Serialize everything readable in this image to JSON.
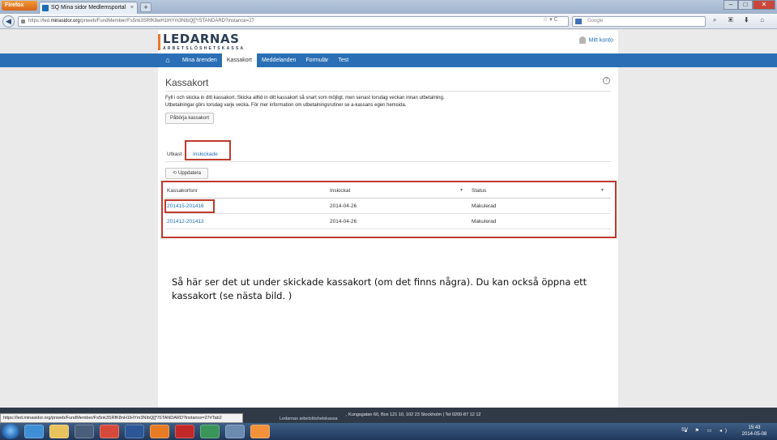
{
  "browser": {
    "menu_button": "Firefox",
    "tab_title": "SQ Mina sidor Medlemsportal",
    "new_tab": "+",
    "url_prefix": "https://led.",
    "url_host": "minasidor.org",
    "url_rest": "/pnweb/FundMember/Fs5nk3SRfK8wH1lHYm3NIbQ[[*/STANDARD?instance=27",
    "search_placeholder": "Google",
    "url_icons": "☆ ▾ C",
    "tools": "⌕ ▣ ⬇ ⌂"
  },
  "site": {
    "logo_word": "LEDARNAS",
    "logo_sub": "ARBETSLÖSHETSKASSA",
    "account_label": "Mitt konto"
  },
  "menu": {
    "items": [
      "Mina ärenden",
      "Kassakort",
      "Meddelanden",
      "Formulär",
      "Test"
    ],
    "active": "Kassakort"
  },
  "content": {
    "title": "Kassakort",
    "help": "?",
    "intro_line1": "Fyll i och skicka in ditt kassakort. Skicka alltid in ditt kassakort så snart som möjligt, men senast torsdag veckan innan utbetalning.",
    "intro_line2": "Utbetalningar görs torsdag varje vecka. För mer information om utbetalningsrutiner se a-kassans egen hemsida.",
    "start_button": "Påbörja kassakort",
    "tab_draft": "Utkast",
    "tab_sent": "Inskickade",
    "update_button": "Uppdatera",
    "table": {
      "headers": [
        "Kassakortsnr",
        "Inskickat",
        "Status"
      ],
      "rows": [
        {
          "nr": "201415-201416",
          "sent": "2014-04-26",
          "status": "Makulerad"
        },
        {
          "nr": "201412-201413",
          "sent": "2014-04-26",
          "status": "Makulerad"
        }
      ]
    },
    "caption": "Så här ser det ut under skickade kassakort (om det finns några). Du kan också öppna ett kassakort (se nästa bild. )"
  },
  "footer": {
    "org": "Ledarnas arbetslöshetskassa",
    "address": ", Kungsgatan 60, Box 121 10, 102 23 Stockholm | Tel 0200-87 12 12",
    "status_url": "https://led.minasidor.org/pnweb/FundMember/Fs5nk3SRfK8nH1lHYm3NIbQ[[*/STANDARD?instance=27#Tab2"
  },
  "taskbar": {
    "lang": "SV",
    "time": "15:43",
    "date": "2014-05-08",
    "tray_icons": "▴ ⚑ ▭ ◂)"
  }
}
